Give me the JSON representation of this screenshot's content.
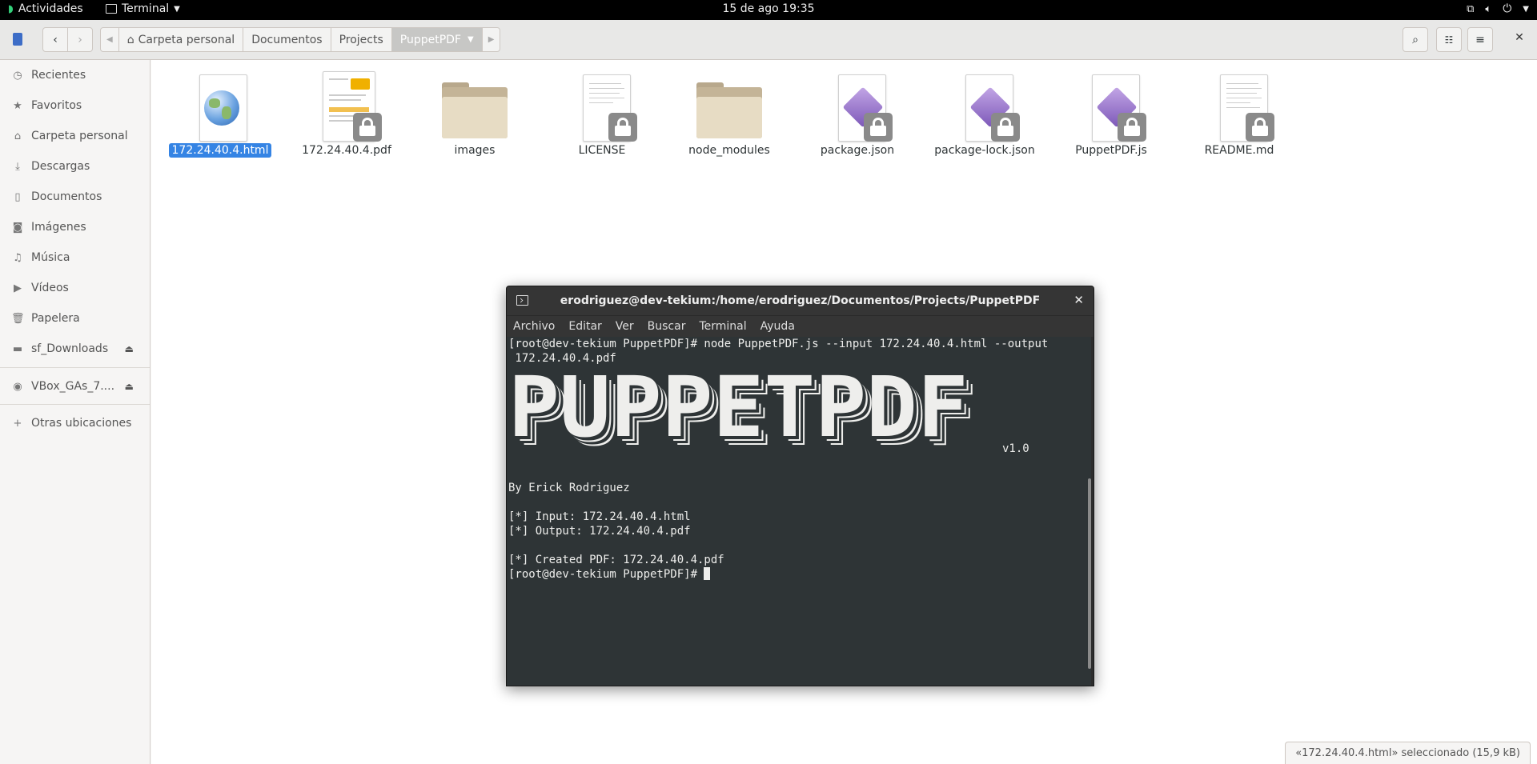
{
  "topbar": {
    "activities": "Actividades",
    "app_name": "Terminal",
    "clock": "15 de ago  19:35"
  },
  "header": {
    "path": [
      "Carpeta personal",
      "Documentos",
      "Projects",
      "PuppetPDF"
    ]
  },
  "sidebar": {
    "items": [
      {
        "label": "Recientes",
        "icon": "clock-icon"
      },
      {
        "label": "Favoritos",
        "icon": "star-icon"
      },
      {
        "label": "Carpeta personal",
        "icon": "home-icon"
      },
      {
        "label": "Descargas",
        "icon": "download-icon"
      },
      {
        "label": "Documentos",
        "icon": "document-icon"
      },
      {
        "label": "Imágenes",
        "icon": "camera-icon"
      },
      {
        "label": "Música",
        "icon": "music-icon"
      },
      {
        "label": "Vídeos",
        "icon": "video-icon"
      },
      {
        "label": "Papelera",
        "icon": "trash-icon"
      },
      {
        "label": "sf_Downloads",
        "icon": "drive-icon"
      },
      {
        "label": "VBox_GAs_7....",
        "icon": "disc-icon"
      },
      {
        "label": "Otras ubicaciones",
        "icon": "plus-icon"
      }
    ]
  },
  "files": [
    {
      "name": "172.24.40.4.html",
      "type": "html",
      "selected": true
    },
    {
      "name": "172.24.40.4.pdf",
      "type": "pdf",
      "locked": true
    },
    {
      "name": "images",
      "type": "folder"
    },
    {
      "name": "LICENSE",
      "type": "text",
      "locked": true
    },
    {
      "name": "node_modules",
      "type": "folder"
    },
    {
      "name": "package.json",
      "type": "code",
      "locked": true
    },
    {
      "name": "package-lock.json",
      "type": "code",
      "locked": true
    },
    {
      "name": "PuppetPDF.js",
      "type": "code",
      "locked": true
    },
    {
      "name": "README.md",
      "type": "text",
      "locked": true
    }
  ],
  "status": "«172.24.40.4.html» seleccionado  (15,9 kB)",
  "terminal": {
    "title": "erodriguez@dev-tekium:/home/erodriguez/Documentos/Projects/PuppetPDF",
    "menu": [
      "Archivo",
      "Editar",
      "Ver",
      "Buscar",
      "Terminal",
      "Ayuda"
    ],
    "cmd_line1": "[root@dev-tekium PuppetPDF]# node PuppetPDF.js --input 172.24.40.4.html --output",
    "cmd_line2": " 172.24.40.4.pdf",
    "banner": "PUPPETPDF",
    "version": "v1.0",
    "author": "By Erick Rodriguez",
    "input": "[*] Input: 172.24.40.4.html",
    "output": "[*] Output: 172.24.40.4.pdf",
    "created": "[*] Created PDF: 172.24.40.4.pdf",
    "prompt": "[root@dev-tekium PuppetPDF]# "
  }
}
